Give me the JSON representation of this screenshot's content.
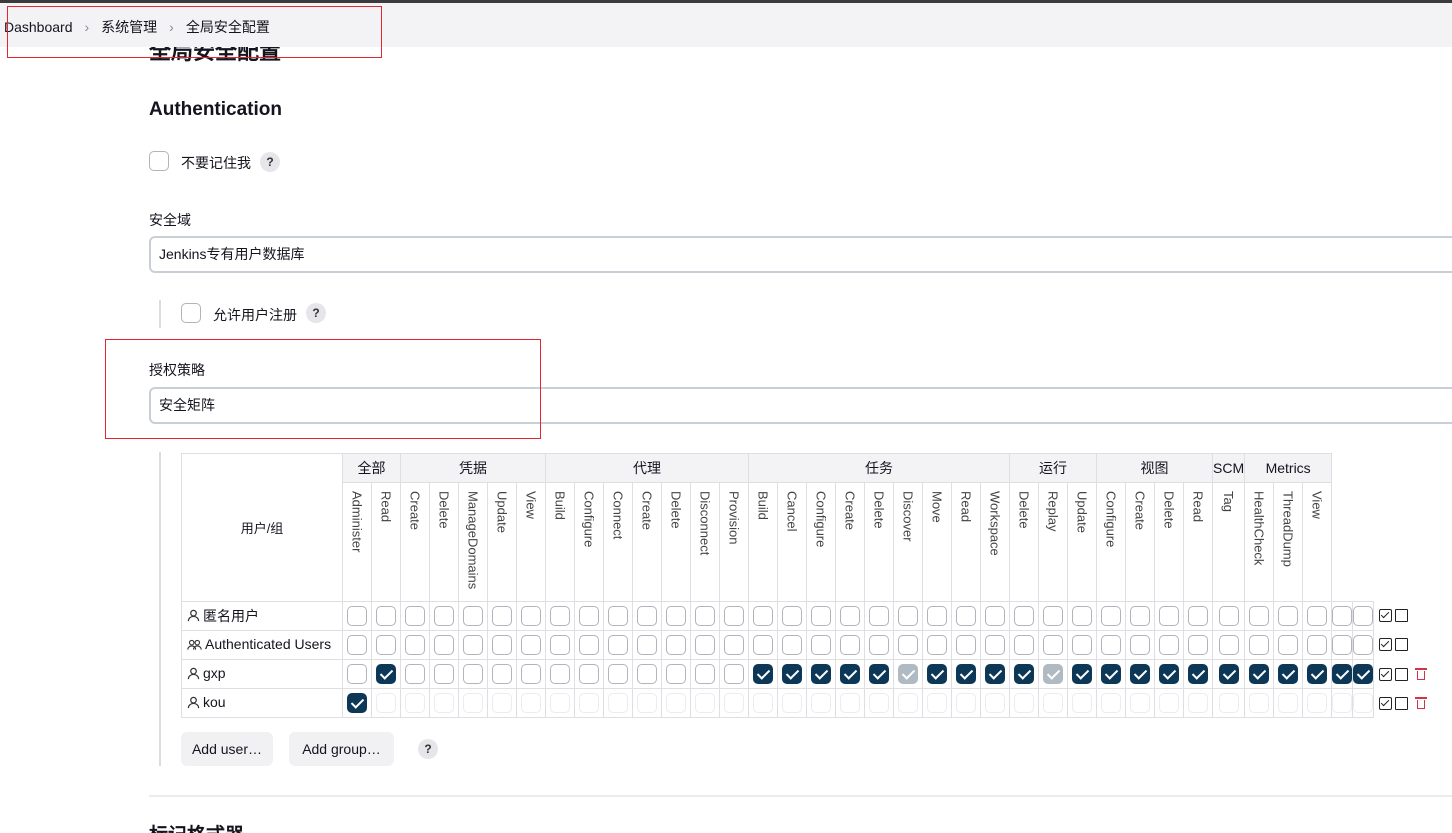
{
  "breadcrumb": [
    "Dashboard",
    "系统管理",
    "全局安全配置"
  ],
  "page_title": "全局安全配置",
  "authentication_title": "Authentication",
  "remember_me_label": "不要记住我",
  "help_glyph": "?",
  "realm_label": "安全域",
  "realm_value": "Jenkins专有用户数据库",
  "allow_signup_label": "允许用户注册",
  "authorization_label": "授权策略",
  "authorization_value": "安全矩阵",
  "matrix": {
    "user_group_header": "用户/组",
    "groups": [
      {
        "name": "全部",
        "perms": [
          "Administer",
          "Read"
        ]
      },
      {
        "name": "凭据",
        "perms": [
          "Create",
          "Delete",
          "ManageDomains",
          "Update",
          "View"
        ]
      },
      {
        "name": "代理",
        "perms": [
          "Build",
          "Configure",
          "Connect",
          "Create",
          "Delete",
          "Disconnect",
          "Provision"
        ]
      },
      {
        "name": "任务",
        "perms": [
          "Build",
          "Cancel",
          "Configure",
          "Create",
          "Delete",
          "Discover",
          "Move",
          "Read",
          "Workspace"
        ]
      },
      {
        "name": "运行",
        "perms": [
          "Delete",
          "Replay",
          "Update"
        ]
      },
      {
        "name": "视图",
        "perms": [
          "Configure",
          "Create",
          "Delete",
          "Read"
        ]
      },
      {
        "name": "SCM",
        "perms": [
          "Tag"
        ]
      },
      {
        "name": "Metrics",
        "perms": [
          "HealthCheck",
          "ThreadDump",
          "View"
        ]
      }
    ],
    "rows": [
      {
        "name": "匿名用户",
        "icon": "user-icon",
        "deletable": false,
        "states": "eeeeeeeeeeeeeeeeeeeeeeeeeeeeeeeeeeee"
      },
      {
        "name": "Authenticated Users",
        "icon": "users-icon",
        "deletable": false,
        "states": "eeeeeeeeeeeeeeeeeeeeeeeeeeeeeeeeeeee"
      },
      {
        "name": "gxp",
        "icon": "user-icon",
        "deletable": true,
        "states": "eceeeeeeeeeeeeccccckcccckccccccccccc"
      },
      {
        "name": "kou",
        "icon": "user-icon",
        "deletable": true,
        "states": "cggggggggggggggggggggggggggggggggggg"
      }
    ]
  },
  "add_user_label": "Add user…",
  "add_group_label": "Add group…",
  "next_section_title": "标记格式器"
}
